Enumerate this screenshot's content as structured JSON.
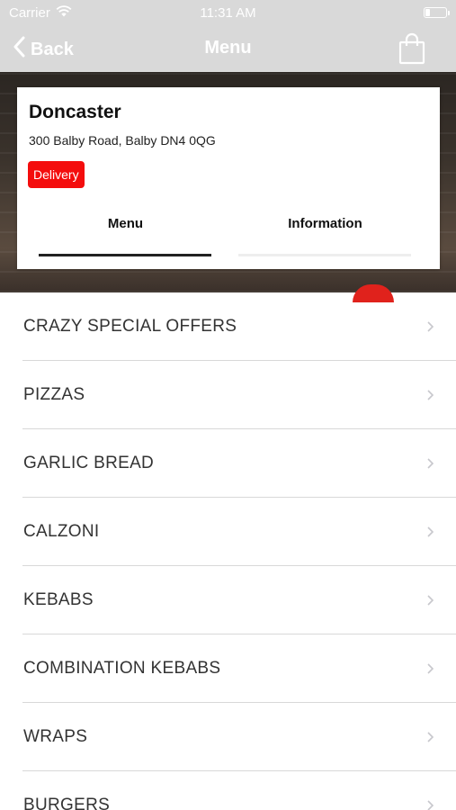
{
  "status_bar": {
    "carrier": "Carrier",
    "time": "11:31 AM"
  },
  "nav": {
    "back_label": "Back",
    "title": "Menu"
  },
  "store": {
    "name": "Doncaster",
    "address": "300 Balby Road, Balby DN4 0QG",
    "badge": "Delivery"
  },
  "tabs": [
    {
      "label": "Menu",
      "active": true
    },
    {
      "label": "Information",
      "active": false
    }
  ],
  "menu_items": [
    {
      "label": "CRAZY SPECIAL OFFERS"
    },
    {
      "label": "PIZZAS"
    },
    {
      "label": "GARLIC BREAD"
    },
    {
      "label": "CALZONI"
    },
    {
      "label": "KEBABS"
    },
    {
      "label": "COMBINATION KEBABS"
    },
    {
      "label": "WRAPS"
    },
    {
      "label": "BURGERS"
    }
  ],
  "colors": {
    "bar_gray": "#d9d9d9",
    "badge_red": "#f40d0d",
    "active_tab_line": "#222222"
  },
  "icons": {
    "wifi": "wifi-icon",
    "battery": "battery-icon",
    "back": "chevron-left-icon",
    "bag": "shopping-bag-icon",
    "row_chevron": "chevron-right-icon"
  }
}
